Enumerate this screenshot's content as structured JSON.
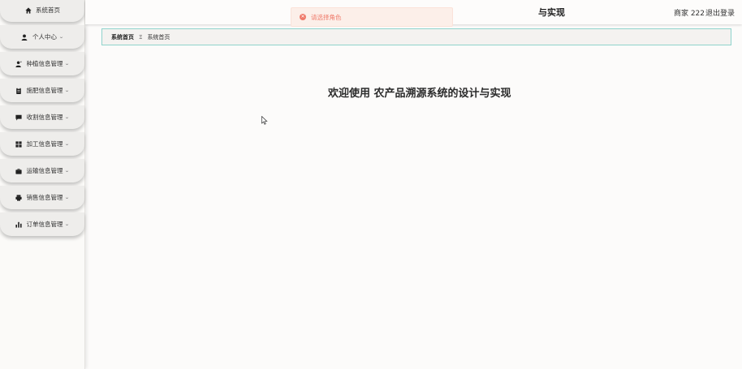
{
  "header": {
    "title_partial": "与实现",
    "user": "商家 222",
    "logout": "退出登录"
  },
  "toast": {
    "message": "请选择角色"
  },
  "breadcrumb": {
    "home": "系统首页",
    "separator": "Ξ",
    "current": "系统首页"
  },
  "main": {
    "welcome": "欢迎使用 农产品溯源系统的设计与实现"
  },
  "sidebar": {
    "items": [
      {
        "label": "系统首页",
        "icon": "home-icon",
        "has_chevron": false
      },
      {
        "label": "个人中心",
        "icon": "user-icon",
        "has_chevron": true
      },
      {
        "label": "种植信息管理",
        "icon": "person-icon",
        "has_chevron": true
      },
      {
        "label": "施肥信息管理",
        "icon": "clipboard-icon",
        "has_chevron": true
      },
      {
        "label": "收割信息管理",
        "icon": "chat-icon",
        "has_chevron": true
      },
      {
        "label": "加工信息管理",
        "icon": "grid-icon",
        "has_chevron": true
      },
      {
        "label": "运输信息管理",
        "icon": "briefcase-icon",
        "has_chevron": true
      },
      {
        "label": "销售信息管理",
        "icon": "printer-icon",
        "has_chevron": true
      },
      {
        "label": "订单信息管理",
        "icon": "bar-chart-icon",
        "has_chevron": true
      }
    ]
  },
  "colors": {
    "toast_text": "#ef7a6a",
    "toast_bg": "#fcefe9",
    "breadcrumb_border": "#8fd3cc"
  }
}
